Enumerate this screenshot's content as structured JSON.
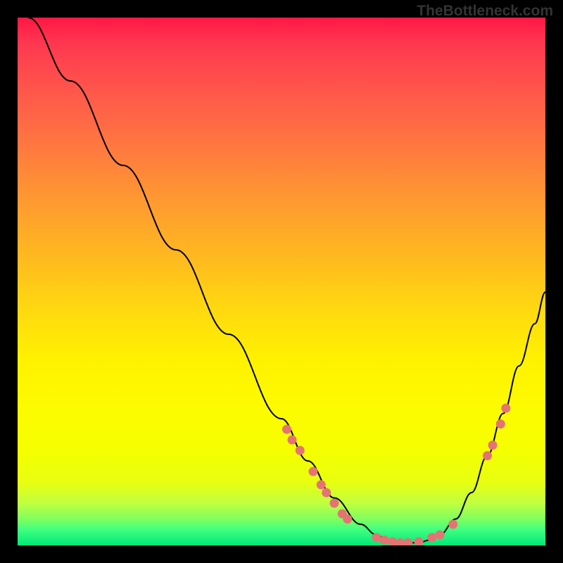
{
  "watermark": "TheBottleneck.com",
  "chart_data": {
    "type": "line",
    "title": "",
    "xlabel": "",
    "ylabel": "",
    "xlim": [
      0,
      100
    ],
    "ylim": [
      0,
      100
    ],
    "curve": {
      "x": [
        2,
        10,
        20,
        30,
        40,
        50,
        55,
        60,
        65,
        68,
        70,
        73,
        76,
        78,
        80,
        83,
        86,
        89,
        92,
        95,
        98,
        100
      ],
      "y": [
        100,
        88,
        72,
        56,
        40,
        24,
        16,
        9,
        4,
        2,
        1,
        0.5,
        0.5,
        1,
        2,
        5,
        10,
        17,
        25,
        34,
        42,
        48
      ]
    },
    "dots": [
      {
        "x": 51,
        "y": 22
      },
      {
        "x": 52,
        "y": 20
      },
      {
        "x": 53.5,
        "y": 18
      },
      {
        "x": 56,
        "y": 14
      },
      {
        "x": 57.5,
        "y": 11.5
      },
      {
        "x": 58.5,
        "y": 10
      },
      {
        "x": 60,
        "y": 8
      },
      {
        "x": 61.5,
        "y": 6
      },
      {
        "x": 62.5,
        "y": 5
      },
      {
        "x": 68,
        "y": 1.5
      },
      {
        "x": 69.5,
        "y": 1
      },
      {
        "x": 71,
        "y": 0.7
      },
      {
        "x": 72.5,
        "y": 0.5
      },
      {
        "x": 74,
        "y": 0.5
      },
      {
        "x": 76,
        "y": 0.7
      },
      {
        "x": 78.5,
        "y": 1.5
      },
      {
        "x": 80,
        "y": 2
      },
      {
        "x": 82.5,
        "y": 4
      },
      {
        "x": 89,
        "y": 17
      },
      {
        "x": 90,
        "y": 19
      },
      {
        "x": 91.5,
        "y": 23
      },
      {
        "x": 92.5,
        "y": 26
      }
    ]
  }
}
